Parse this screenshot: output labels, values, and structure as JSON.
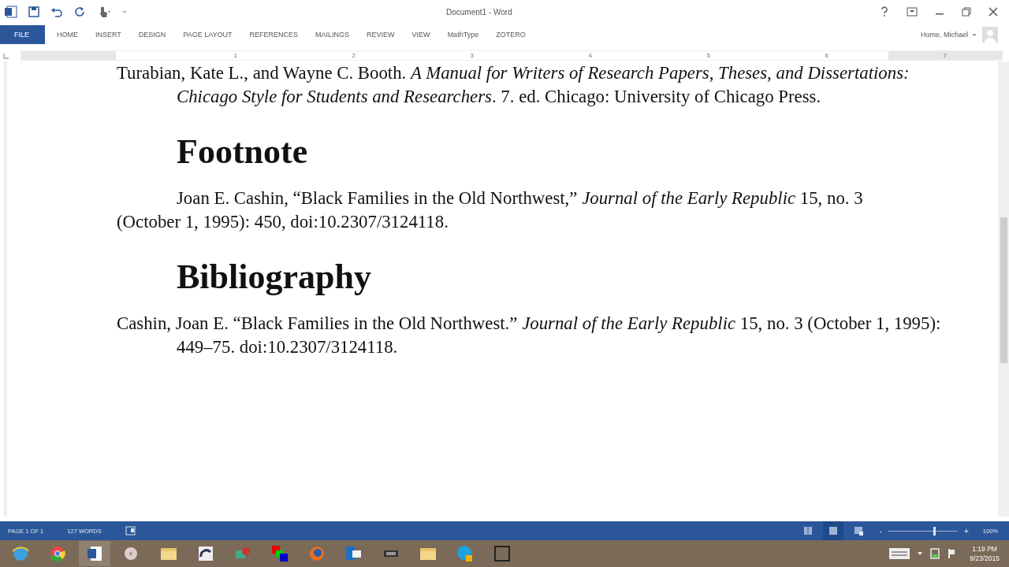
{
  "window": {
    "title": "Document1 - Word",
    "user": "Home, Michael"
  },
  "ribbon_tabs": [
    {
      "label": "FILE",
      "kind": "file"
    },
    {
      "label": "HOME",
      "kind": "tab"
    },
    {
      "label": "INSERT",
      "kind": "tab"
    },
    {
      "label": "DESIGN",
      "kind": "tab"
    },
    {
      "label": "PAGE LAYOUT",
      "kind": "tab"
    },
    {
      "label": "REFERENCES",
      "kind": "tab"
    },
    {
      "label": "MAILINGS",
      "kind": "tab"
    },
    {
      "label": "REVIEW",
      "kind": "tab"
    },
    {
      "label": "VIEW",
      "kind": "tab"
    },
    {
      "label": "MathType",
      "kind": "tab"
    },
    {
      "label": "ZOTERO",
      "kind": "tab"
    }
  ],
  "ruler": {
    "numbers": [
      "1",
      "2",
      "3",
      "4",
      "5",
      "6",
      "7"
    ]
  },
  "document": [
    {
      "kind": "entry",
      "text": "Turabian, Kate L., and Wayne C. Booth. *A Manual for Writers of Research Papers, Theses, and Dissertations: Chicago Style for Students and Researchers*. 7. ed. Chicago: University of Chicago Press."
    },
    {
      "kind": "heading",
      "text": "Footnote"
    },
    {
      "kind": "note",
      "text": "Joan E. Cashin, “Black Families in the Old Northwest,” *Journal of the Early Republic* 15, no. 3 (October 1, 1995): 450, doi:10.2307/3124118."
    },
    {
      "kind": "heading",
      "text": "Bibliography"
    },
    {
      "kind": "entry",
      "text": "Cashin, Joan E. “Black Families in the Old Northwest.” *Journal of the Early Republic* 15, no. 3 (October 1, 1995): 449–75. doi:10.2307/3124118."
    }
  ],
  "status_bar": {
    "page": "PAGE 1 OF 1",
    "words": "127 WORDS",
    "views": [
      {
        "selected": false
      },
      {
        "selected": true
      },
      {
        "selected": false
      }
    ],
    "zoom_minus": "-",
    "zoom_plus": "+",
    "zoom": {
      "level": 0.65
    },
    "zoom_reading": "100%"
  },
  "taskbar": {
    "time": "1:19 PM",
    "date": "9/23/2015"
  }
}
